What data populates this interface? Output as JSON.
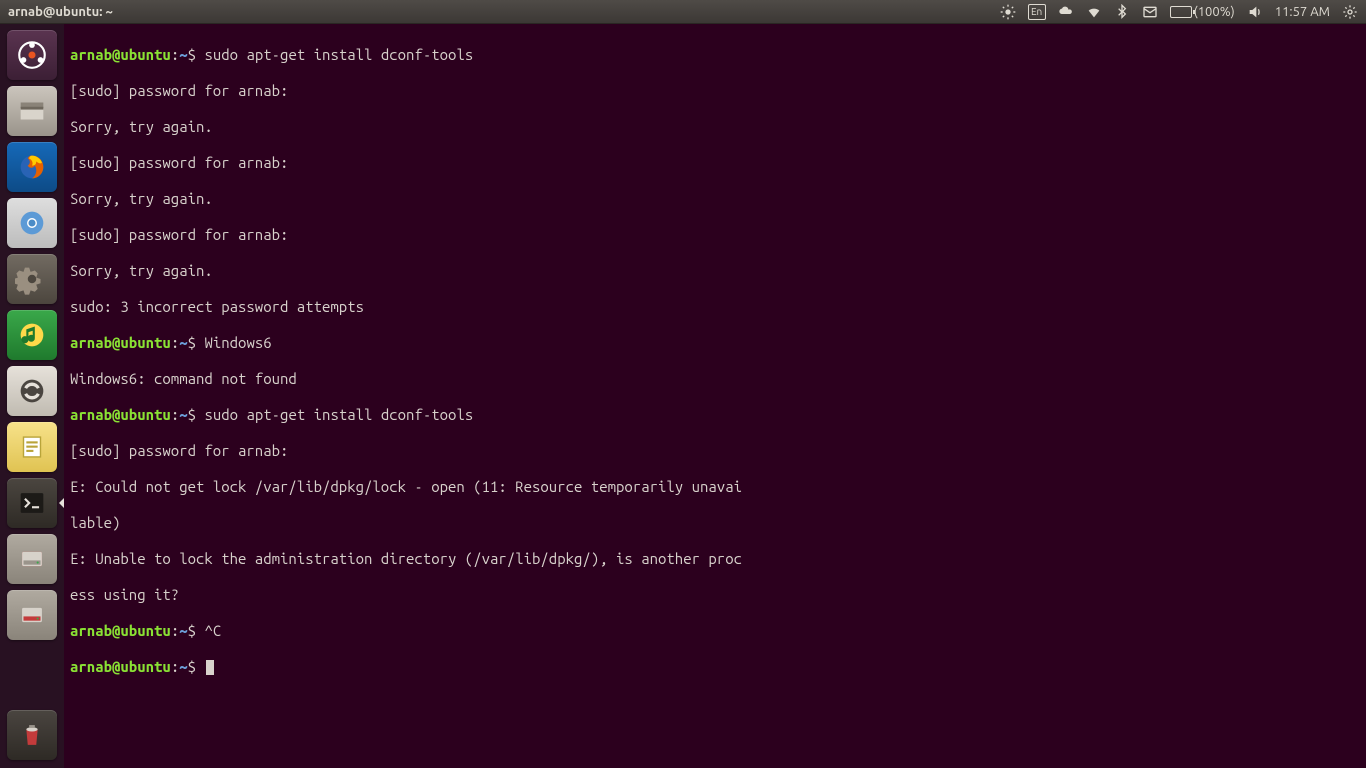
{
  "window": {
    "title": "arnab@ubuntu: ~"
  },
  "panel": {
    "lang": "En",
    "battery_pct": "(100%)",
    "clock": "11:57 AM"
  },
  "prompt": {
    "user_host": "arnab@ubuntu",
    "sep": ":",
    "path": "~",
    "sigil": "$"
  },
  "lines": {
    "l0_cmd": "sudo apt-get install dconf-tools",
    "l1": "[sudo] password for arnab:",
    "l2": "Sorry, try again.",
    "l3": "[sudo] password for arnab:",
    "l4": "Sorry, try again.",
    "l5": "[sudo] password for arnab:",
    "l6": "Sorry, try again.",
    "l7": "sudo: 3 incorrect password attempts",
    "l8_cmd": "Windows6",
    "l9": "Windows6: command not found",
    "l10_cmd": "sudo apt-get install dconf-tools",
    "l11": "[sudo] password for arnab:",
    "l12": "E: Could not get lock /var/lib/dpkg/lock - open (11: Resource temporarily unavai",
    "l13": "lable)",
    "l14": "E: Unable to lock the administration directory (/var/lib/dpkg/), is another proc",
    "l15": "ess using it?",
    "l16_cmd": "^C",
    "l17_cmd": ""
  },
  "launcher": {
    "items": [
      {
        "name": "dash",
        "tip": "Dash Home"
      },
      {
        "name": "files",
        "tip": "Files"
      },
      {
        "name": "firefox",
        "tip": "Firefox"
      },
      {
        "name": "chromium",
        "tip": "Chromium"
      },
      {
        "name": "settings",
        "tip": "System Settings"
      },
      {
        "name": "music",
        "tip": "Music Player"
      },
      {
        "name": "software-updater",
        "tip": "Software Updater"
      },
      {
        "name": "office",
        "tip": "LibreOffice"
      },
      {
        "name": "terminal",
        "tip": "Terminal"
      },
      {
        "name": "disk1",
        "tip": "Volume"
      },
      {
        "name": "disk2",
        "tip": "Volume"
      },
      {
        "name": "trash",
        "tip": "Trash"
      }
    ]
  }
}
